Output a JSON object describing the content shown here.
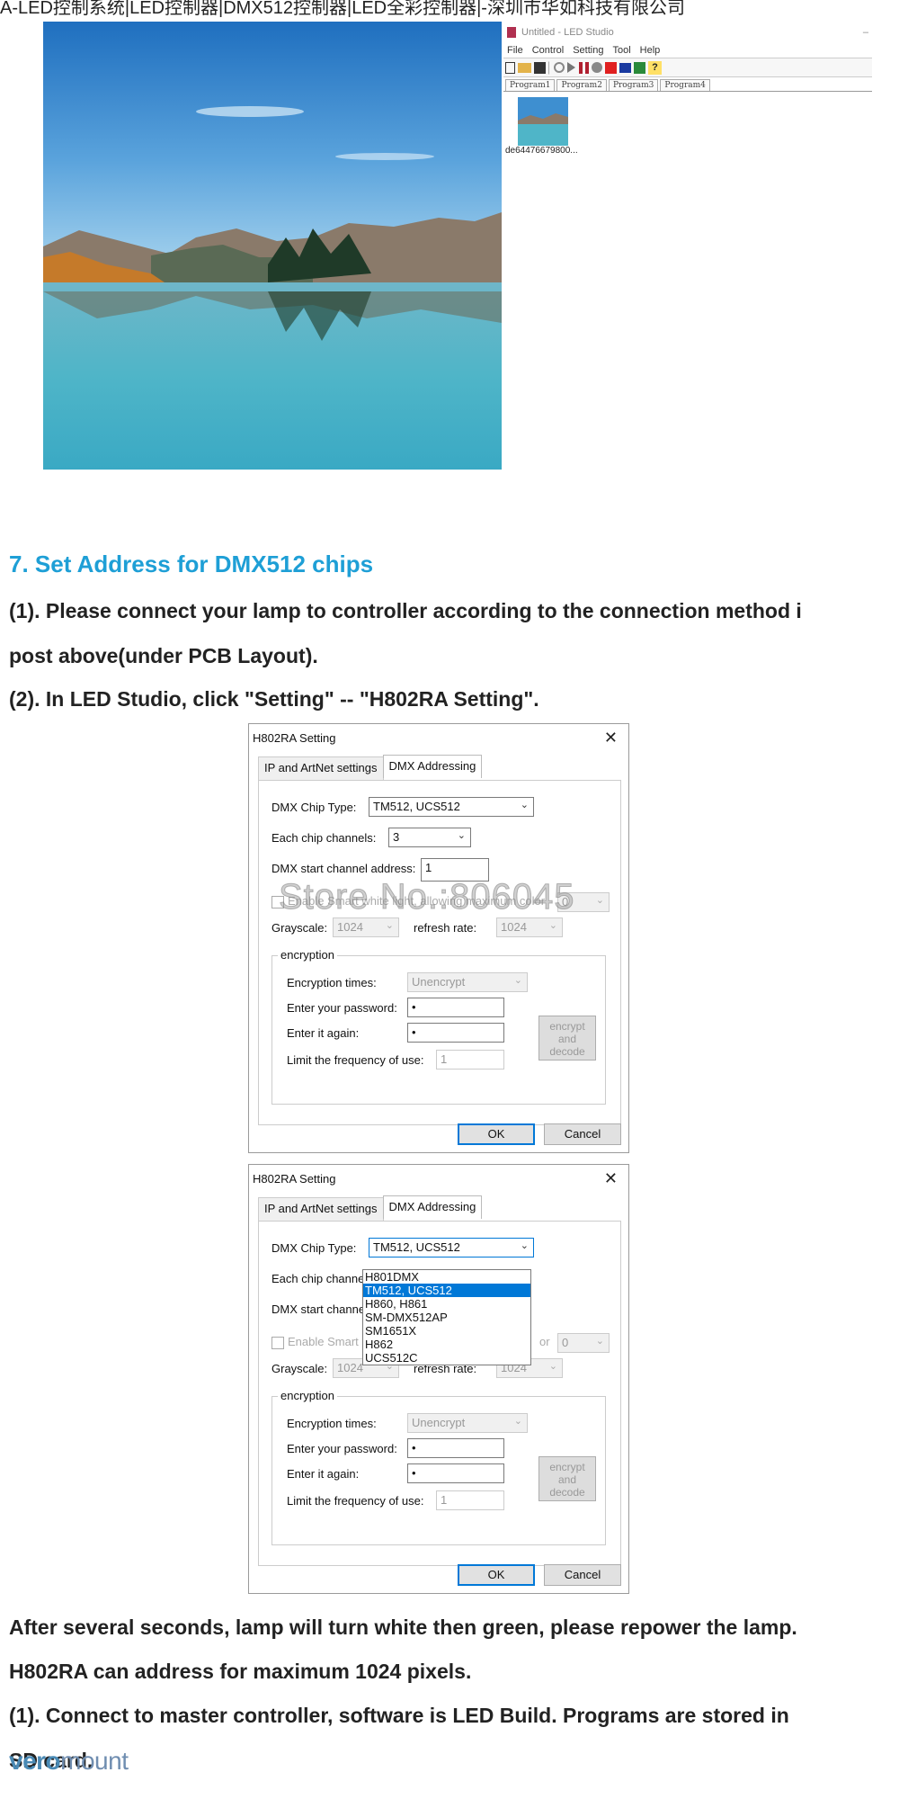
{
  "top_line": "A-LED控制系统|LED控制器|DMX512控制器|LED全彩控制器|-深圳市华如科技有限公司",
  "studio": {
    "title": "Untitled - LED Studio",
    "minimize": "–",
    "menu": [
      "File",
      "Control",
      "Setting",
      "Tool",
      "Help"
    ],
    "program_tabs": [
      "Program1",
      "Program2",
      "Program3",
      "Program4"
    ],
    "thumb_name": "de64476679800..."
  },
  "section_heading": "7. Set Address for DMX512 chips",
  "paragraphs": {
    "p1a": "(1). Please connect your lamp to controller according to the connection method i",
    "p1b": "post above(under PCB Layout).",
    "p2": "(2). In LED Studio, click \"Setting\" -- \"H802RA  Setting\".",
    "p3": "After several seconds, lamp will turn white then green, please repower the lamp.",
    "p4": "H802RA can address for maximum 1024 pixels.",
    "p5a": "(1). Connect to master controller, software is LED Build. Programs are stored in",
    "p5b": "SD card."
  },
  "dialog1": {
    "title": "H802RA Setting",
    "close": "✕",
    "tabs": [
      "IP and ArtNet settings",
      "DMX Addressing"
    ],
    "chip_type_label": "DMX Chip Type:",
    "chip_type_value": "TM512, UCS512",
    "channels_label": "Each chip channels:",
    "channels_value": "3",
    "start_label": "DMX start channel address:",
    "start_value": "1",
    "smart_white_label": "Enable Smart white light, allowing maximum color",
    "smart_white_value": "0",
    "grayscale_label": "Grayscale:",
    "grayscale_value": "1024",
    "refresh_label": "refresh rate:",
    "refresh_value": "1024",
    "encryption_group": "encryption",
    "enc_times_label": "Encryption times:",
    "enc_times_value": "Unencrypt",
    "password_label": "Enter your password:",
    "password_value": "•",
    "again_label": "Enter it again:",
    "again_value": "•",
    "limit_label": "Limit the frequency of use:",
    "limit_value": "1",
    "encrypt_button": "encrypt and decode",
    "ok": "OK",
    "cancel": "Cancel"
  },
  "watermark": "Store No.:806045",
  "dialog2": {
    "title": "H802RA Setting",
    "close": "✕",
    "tabs": [
      "IP and ArtNet settings",
      "DMX Addressing"
    ],
    "chip_type_label": "DMX Chip Type:",
    "chip_type_value": "TM512, UCS512",
    "dropdown_options": [
      "H801DMX",
      "TM512, UCS512",
      "H860, H861",
      "SM-DMX512AP",
      "SM1651X",
      "H862",
      "UCS512C"
    ],
    "selected_index": 1,
    "channels_label_partial": "Each chip channe",
    "start_label_partial": "DMX start channe",
    "smart_white_partial": "Enable Smart",
    "color_partial": "or",
    "smart_white_value": "0",
    "grayscale_label": "Grayscale:",
    "grayscale_value": "1024",
    "refresh_label": "refresh rate:",
    "refresh_value": "1024",
    "encryption_group": "encryption",
    "enc_times_label": "Encryption times:",
    "enc_times_value": "Unencrypt",
    "password_label": "Enter your password:",
    "password_value": "•",
    "again_label": "Enter it again:",
    "again_value": "•",
    "limit_label": "Limit the frequency of use:",
    "limit_value": "1",
    "encrypt_button": "encrypt and decode",
    "ok": "OK",
    "cancel": "Cancel"
  },
  "logo": {
    "part1": "vero",
    "part2": "mount"
  }
}
